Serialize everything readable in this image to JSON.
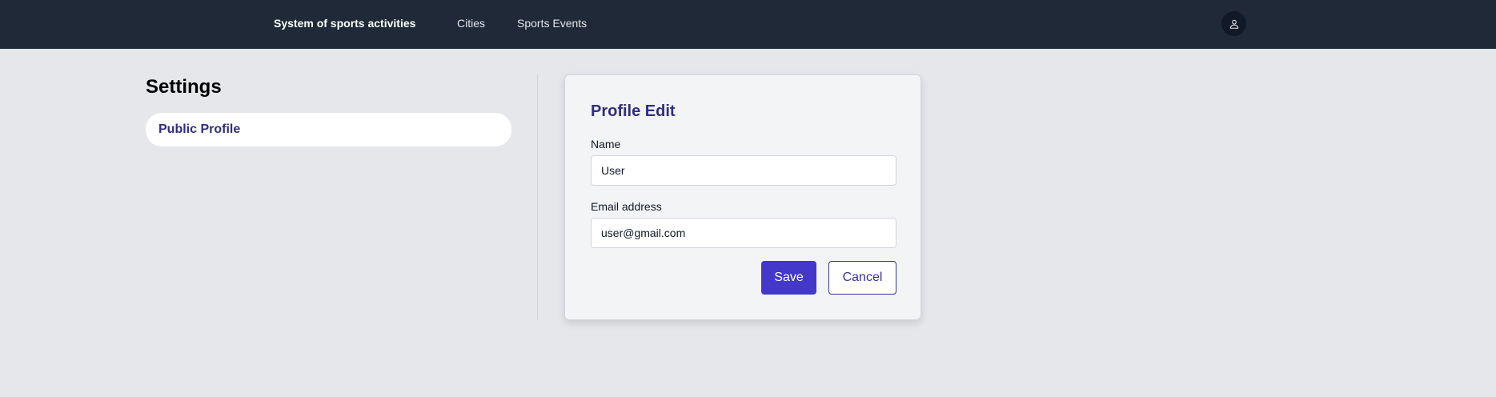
{
  "header": {
    "brand": "System of sports activities",
    "nav": [
      {
        "label": "Cities"
      },
      {
        "label": "Sports Events"
      }
    ],
    "user_icon": "user-icon"
  },
  "sidebar": {
    "title": "Settings",
    "items": [
      {
        "label": "Public Profile",
        "active": true
      }
    ]
  },
  "profile_form": {
    "title": "Profile Edit",
    "fields": {
      "name": {
        "label": "Name",
        "value": "User"
      },
      "email": {
        "label": "Email address",
        "value": "user@gmail.com"
      }
    },
    "save_label": "Save",
    "cancel_label": "Cancel"
  },
  "colors": {
    "topbar": "#1f2937",
    "background": "#e5e7eb",
    "accent": "#4338ca",
    "heading_accent": "#312e81"
  }
}
